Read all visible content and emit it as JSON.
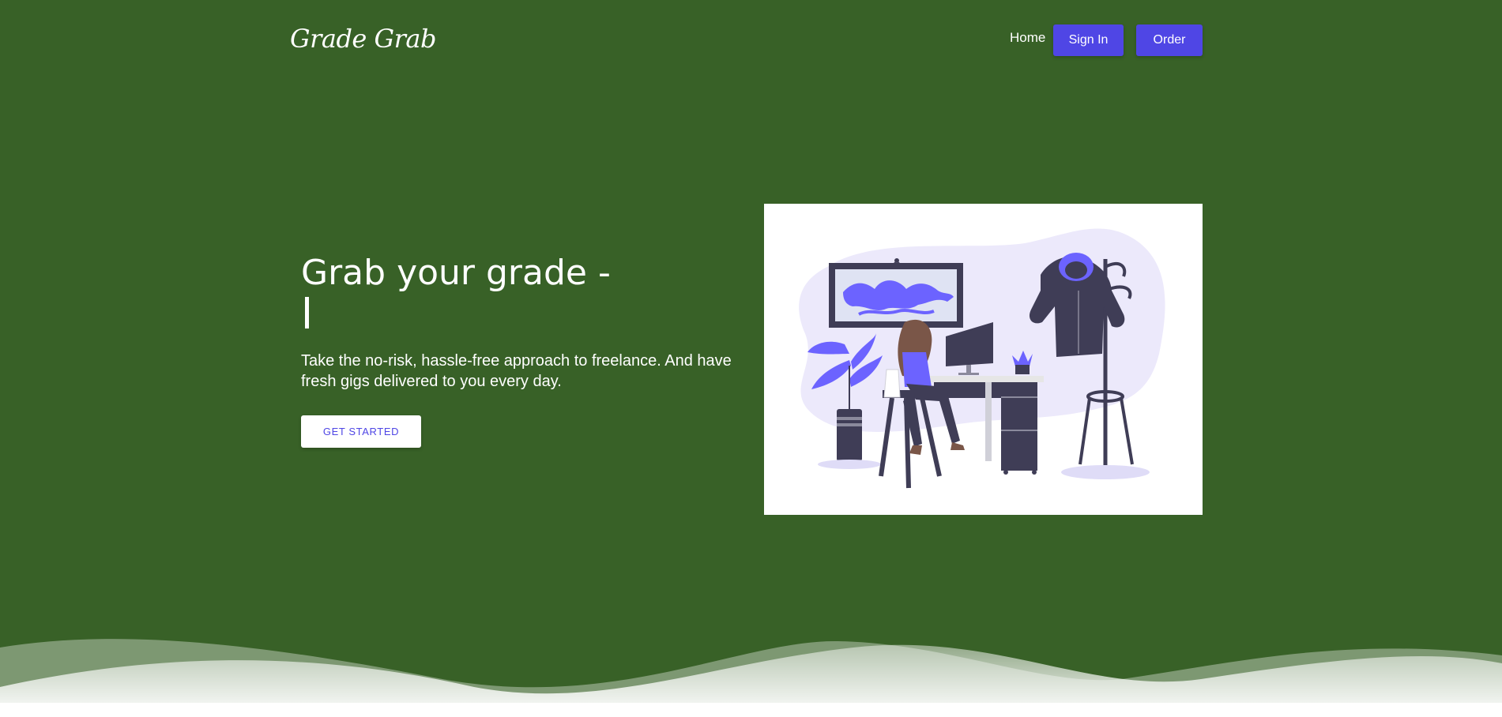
{
  "header": {
    "logo": "Grade Grab",
    "nav": {
      "home": "Home",
      "sign_in": "Sign In",
      "order": "Order"
    }
  },
  "hero": {
    "title": "Grab your grade -",
    "subtitle": "Take the no-risk, hassle-free approach to freelance. And have fresh gigs delivered to you every day.",
    "cta": "GET STARTED"
  },
  "colors": {
    "background": "#386127",
    "accent": "#4f46e5",
    "illustration_purple": "#6c63ff",
    "illustration_dark": "#3f3d56"
  },
  "icons": {
    "hero_illustration": "woman-working-at-desk-illustration"
  }
}
